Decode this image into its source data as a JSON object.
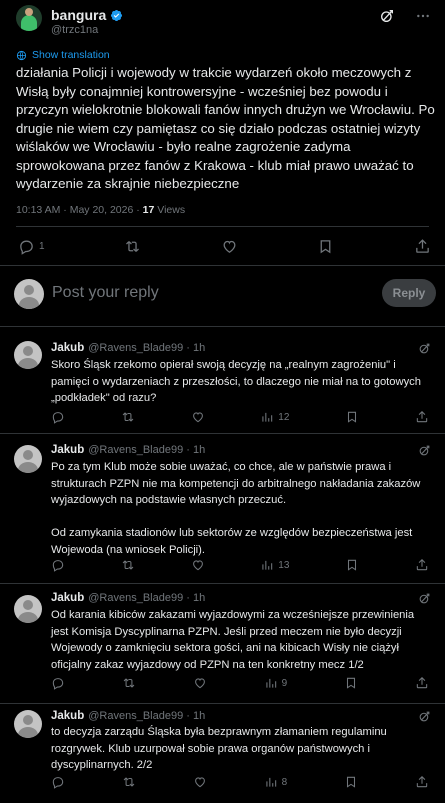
{
  "main_tweet": {
    "author_name": "bangura",
    "author_handle": "@trzc1na",
    "show_translation": "Show translation",
    "text": "działania Policji i wojewody w trakcie wydarzeń około meczowych z Wisłą były conajmniej kontrowersyjne - wcześniej bez powodu i przyczyn wielokrotnie blokowali fanów innych drużyn we Wrocławiu. Po drugie nie wiem czy pamiętasz co się działo podczas ostatniej wizyty wiślaków we Wrocławiu - było realne zagrożenie zadyma sprowokowana przez fanów z Krakowa - klub miał prawo uważać to wydarzenie za skrajnie niebezpieczne",
    "time": "10:13 AM · May 20, 2026 · ",
    "views_count": "17",
    "views_label": " Views",
    "reply_count": "1"
  },
  "composer": {
    "placeholder": "Post your reply",
    "reply_button": "Reply"
  },
  "replies": [
    {
      "name": "Jakub",
      "handle": "@Ravens_Blade99 · 1h",
      "text": "Skoro Śląsk rzekomo opierał swoją decyzję na „realnym zagrożeniu\" i pamięci o wydarzeniach z przeszłości, to dlaczego nie miał na to gotowych „podkładek\" od razu?",
      "views": "12"
    },
    {
      "name": "Jakub",
      "handle": "@Ravens_Blade99 · 1h",
      "text": "Po za tym Klub może sobie uważać, co chce, ale w państwie prawa i strukturach PZPN nie ma kompetencji do arbitralnego nakładania zakazów wyjazdowych na podstawie własnych przeczuć.\n\nOd zamykania stadionów lub sektorów ze względów bezpieczeństwa jest Wojewoda (na wniosek Policji).",
      "views": "13"
    },
    {
      "name": "Jakub",
      "handle": "@Ravens_Blade99 · 1h",
      "text": "Od karania kibiców zakazami wyjazdowymi za wcześniejsze przewinienia jest Komisja Dyscyplinarna PZPN. Jeśli przed meczem nie było decyzji Wojewody o zamknięciu sektora gości, ani na kibicach Wisły nie ciążył oficjalny zakaz wyjazdowy od PZPN na ten konkretny mecz 1/2",
      "views": "9"
    },
    {
      "name": "Jakub",
      "handle": "@Ravens_Blade99 · 1h",
      "text": "to decyzja zarządu Śląska była bezprawnym złamaniem regulaminu rozgrywek. Klub uzurpował sobie prawa organów państwowych i dyscyplinarnych. 2/2",
      "views": "8"
    }
  ],
  "colors": {
    "background": "#000000",
    "text": "#e7e9ea",
    "muted": "#71767b",
    "accent": "#1d9bf0",
    "divider": "#2f3336"
  },
  "icons": [
    "verified-badge-icon",
    "grok-icon",
    "more-icon",
    "translate-icon",
    "reply-icon",
    "retweet-icon",
    "like-icon",
    "bookmark-icon",
    "share-icon",
    "views-icon"
  ]
}
